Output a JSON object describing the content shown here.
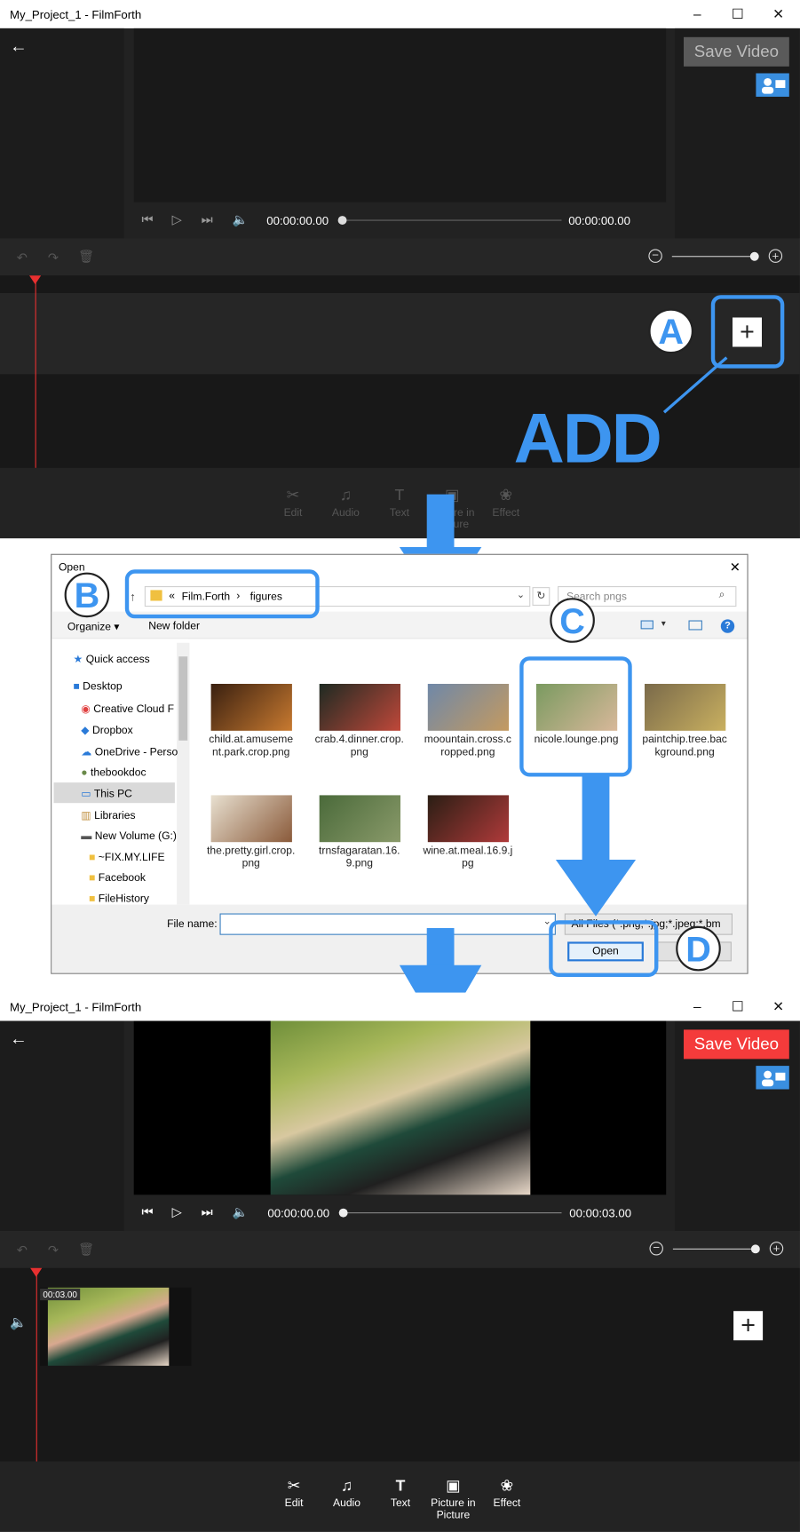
{
  "window_title": "My_Project_1 - FilmForth",
  "window_controls": {
    "minimize": "–",
    "maximize": "☐",
    "close": "✕"
  },
  "top_app": {
    "save_label": "Save Video",
    "time_current": "00:00:00.00",
    "time_total": "00:00:00.00"
  },
  "bottom_app": {
    "save_label": "Save Video",
    "time_current": "00:00:00.00",
    "time_total": "00:00:03.00",
    "clip_duration": "00:03.00"
  },
  "toolbar": [
    {
      "label": "Edit",
      "icon": "scissors-icon",
      "glyph": "✂"
    },
    {
      "label": "Audio",
      "icon": "music-note-icon",
      "glyph": "♫"
    },
    {
      "label": "Text",
      "icon": "text-icon",
      "glyph": "T"
    },
    {
      "label": "Picture in Picture",
      "icon": "picture-icon",
      "glyph": "▣"
    },
    {
      "label": "Effect",
      "icon": "effect-icon",
      "glyph": "❀"
    }
  ],
  "annotations": {
    "a": "A",
    "b": "B",
    "c": "C",
    "d": "D",
    "add": "ADD"
  },
  "dialog": {
    "title": "Open",
    "close": "✕",
    "path_prefix": "«",
    "path_folder1": "Film.Forth",
    "path_sep": "›",
    "path_folder2": "figures",
    "search_placeholder": "Search pngs",
    "organize": "Organize ▾",
    "new_folder": "New folder",
    "help": "?",
    "sidebar": [
      "Quick access",
      "Desktop",
      "Creative Cloud F",
      "Dropbox",
      "OneDrive - Perso",
      "thebookdoc",
      "This PC",
      "Libraries",
      "New Volume (G:)",
      "~FIX.MY.LIFE",
      "Facebook",
      "FileHistory"
    ],
    "files": [
      {
        "name": "child.at.amusement.park.crop.png",
        "c1": "#3a2010",
        "c2": "#c87a30"
      },
      {
        "name": "crab.4.dinner.crop.png",
        "c1": "#1e2a22",
        "c2": "#c0483a"
      },
      {
        "name": "moountain.cross.cropped.png",
        "c1": "#6f88a8",
        "c2": "#c49a60"
      },
      {
        "name": "nicole.lounge.png",
        "c1": "#7a9a60",
        "c2": "#d8b89a"
      },
      {
        "name": "paintchip.tree.background.png",
        "c1": "#7a6a4a",
        "c2": "#c9b060"
      },
      {
        "name": "the.pretty.girl.crop.png",
        "c1": "#e8e0d0",
        "c2": "#8a5a3a"
      },
      {
        "name": "trnsfagaratan.16.9.png",
        "c1": "#4a6a3a",
        "c2": "#8a9a6a"
      },
      {
        "name": "wine.at.meal.16.9.jpg",
        "c1": "#2a1e14",
        "c2": "#b03a3a"
      }
    ],
    "file_name_label": "File name:",
    "file_name_value": "",
    "file_type": "All Files (*.png;*.jpg;*.jpeg;*.bm",
    "open_label": "Open",
    "cancel_label": "Cancel"
  },
  "colors": {
    "accent": "#3d95f0",
    "save_active": "#f43b3b",
    "playhead": "#e83030"
  }
}
